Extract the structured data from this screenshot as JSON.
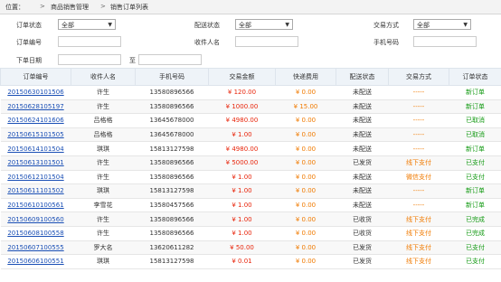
{
  "breadcrumb": {
    "location_label": "位置：",
    "level1": "商品销售管理",
    "level2": "销售订单列表"
  },
  "filters": {
    "order_status_label": "订单状态",
    "order_status_value": "全部",
    "delivery_status_label": "配送状态",
    "delivery_status_value": "全部",
    "payment_method_label": "交易方式",
    "payment_method_value": "全部",
    "order_no_label": "订单编号",
    "order_no_value": "",
    "receiver_label": "收件人名",
    "receiver_value": "",
    "phone_label": "手机号码",
    "phone_value": "",
    "order_date_label": "下单日期",
    "date_from": "",
    "date_to_label": "至",
    "date_to": ""
  },
  "table": {
    "headers": [
      "订单编号",
      "收件人名",
      "手机号码",
      "交易金额",
      "快递费用",
      "配送状态",
      "交易方式",
      "订单状态"
    ],
    "rows": [
      {
        "order_no": "20150630101506",
        "receiver": "许生",
        "phone": "13580896566",
        "amount": "¥ 120.00",
        "fee": "¥ 0.00",
        "delivery": "未配送",
        "payment": "-----",
        "status": "新订单",
        "status_color": "green"
      },
      {
        "order_no": "20150628105197",
        "receiver": "许生",
        "phone": "13580896566",
        "amount": "¥ 1000.00",
        "fee": "¥ 15.00",
        "delivery": "未配送",
        "payment": "-----",
        "status": "新订单",
        "status_color": "green"
      },
      {
        "order_no": "20150624101606",
        "receiver": "吕格格",
        "phone": "13645678000",
        "amount": "¥ 4980.00",
        "fee": "¥ 0.00",
        "delivery": "未配送",
        "payment": "-----",
        "status": "已取消",
        "status_color": "green"
      },
      {
        "order_no": "20150615101505",
        "receiver": "吕格格",
        "phone": "13645678000",
        "amount": "¥ 1.00",
        "fee": "¥ 0.00",
        "delivery": "未配送",
        "payment": "-----",
        "status": "已取消",
        "status_color": "green"
      },
      {
        "order_no": "20150614101504",
        "receiver": "琪琪",
        "phone": "15813127598",
        "amount": "¥ 4980.00",
        "fee": "¥ 0.00",
        "delivery": "未配送",
        "payment": "-----",
        "status": "新订单",
        "status_color": "green"
      },
      {
        "order_no": "20150613101501",
        "receiver": "许生",
        "phone": "13580896566",
        "amount": "¥ 5000.00",
        "fee": "¥ 0.00",
        "delivery": "已发货",
        "payment": "线下支付",
        "status": "已支付",
        "status_color": "green"
      },
      {
        "order_no": "20150612101504",
        "receiver": "许生",
        "phone": "13580896566",
        "amount": "¥ 1.00",
        "fee": "¥ 0.00",
        "delivery": "未配送",
        "payment": "微信支付",
        "status": "已支付",
        "status_color": "green"
      },
      {
        "order_no": "20150611101502",
        "receiver": "琪琪",
        "phone": "15813127598",
        "amount": "¥ 1.00",
        "fee": "¥ 0.00",
        "delivery": "未配送",
        "payment": "-----",
        "status": "新订单",
        "status_color": "green"
      },
      {
        "order_no": "20150610100561",
        "receiver": "李雪花",
        "phone": "13580457566",
        "amount": "¥ 1.00",
        "fee": "¥ 0.00",
        "delivery": "未配送",
        "payment": "-----",
        "status": "新订单",
        "status_color": "green"
      },
      {
        "order_no": "20150609100560",
        "receiver": "许生",
        "phone": "13580896566",
        "amount": "¥ 1.00",
        "fee": "¥ 0.00",
        "delivery": "已收货",
        "payment": "线下支付",
        "status": "已完成",
        "status_color": "green"
      },
      {
        "order_no": "20150608100558",
        "receiver": "许生",
        "phone": "13580896566",
        "amount": "¥ 1.00",
        "fee": "¥ 0.00",
        "delivery": "已收货",
        "payment": "线下支付",
        "status": "已完成",
        "status_color": "green"
      },
      {
        "order_no": "20150607100555",
        "receiver": "罗大名",
        "phone": "13620611282",
        "amount": "¥ 50.00",
        "fee": "¥ 0.00",
        "delivery": "已发货",
        "payment": "线下支付",
        "status": "已支付",
        "status_color": "green"
      },
      {
        "order_no": "20150606100551",
        "receiver": "琪琪",
        "phone": "15813127598",
        "amount": "¥ 0.01",
        "fee": "¥ 0.00",
        "delivery": "已发货",
        "payment": "线下支付",
        "status": "已支付",
        "status_color": "green"
      }
    ]
  },
  "colors": {
    "accent_blue": "#1a4fb5",
    "amount_red": "#e8260c",
    "payment_orange": "#f07a00",
    "status_green": "#139a13",
    "header_bg": "#eef3f8"
  }
}
